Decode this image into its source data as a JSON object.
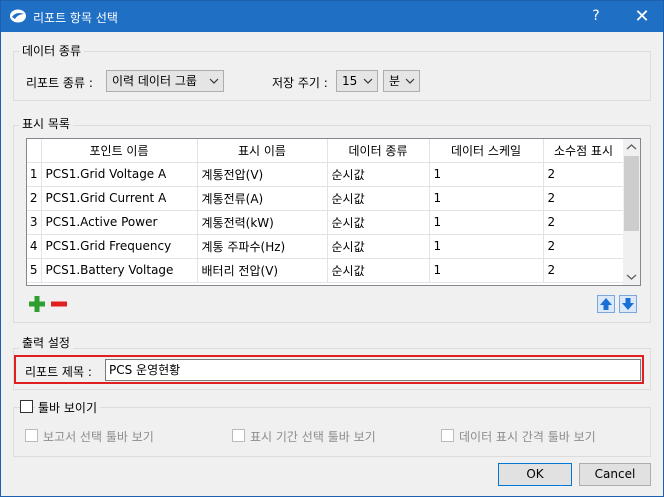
{
  "window": {
    "title": "리포트 항목 선택",
    "help_label": "?",
    "close_label": "✕"
  },
  "data_type_group": {
    "label": "데이터 종류",
    "report_type_label": "리포트 종류 :",
    "report_type_value": "이력 데이터 그룹",
    "save_cycle_label": "저장 주기 :",
    "save_cycle_value": "15",
    "save_cycle_unit": "분"
  },
  "display_list_group": {
    "label": "표시 목록",
    "columns": [
      "포인트 이름",
      "표시 이름",
      "데이터 종류",
      "데이터 스케일",
      "소수점 표시"
    ],
    "rows": [
      {
        "num": "1",
        "point": "PCS1.Grid Voltage A",
        "display": "계통전압(V)",
        "type": "순시값",
        "scale": "1",
        "decimal": "2"
      },
      {
        "num": "2",
        "point": "PCS1.Grid Current A",
        "display": "계통전류(A)",
        "type": "순시값",
        "scale": "1",
        "decimal": "2"
      },
      {
        "num": "3",
        "point": "PCS1.Active Power",
        "display": "계통전력(kW)",
        "type": "순시값",
        "scale": "1",
        "decimal": "2"
      },
      {
        "num": "4",
        "point": "PCS1.Grid Frequency",
        "display": "계통 주파수(Hz)",
        "type": "순시값",
        "scale": "1",
        "decimal": "2"
      },
      {
        "num": "5",
        "point": "PCS1.Battery Voltage",
        "display": "배터리 전압(V)",
        "type": "순시값",
        "scale": "1",
        "decimal": "2"
      }
    ]
  },
  "output_group": {
    "label": "출력 설정",
    "report_title_label": "리포트 제목 :",
    "report_title_value": "PCS 운영현황"
  },
  "toolbar_group": {
    "label": "툴바 보이기",
    "options": [
      "보고서 선택 툴바 보기",
      "표시 기간 선택 툴바 보기",
      "데이터 표시 간격 툴바 보기"
    ]
  },
  "buttons": {
    "ok": "OK",
    "cancel": "Cancel"
  },
  "colors": {
    "titlebar": "#1f6fc5",
    "highlight_border": "#e02020",
    "add_icon": "#2e9e2e",
    "remove_icon": "#e01e1e",
    "arrow_icon": "#1a6fd6"
  }
}
